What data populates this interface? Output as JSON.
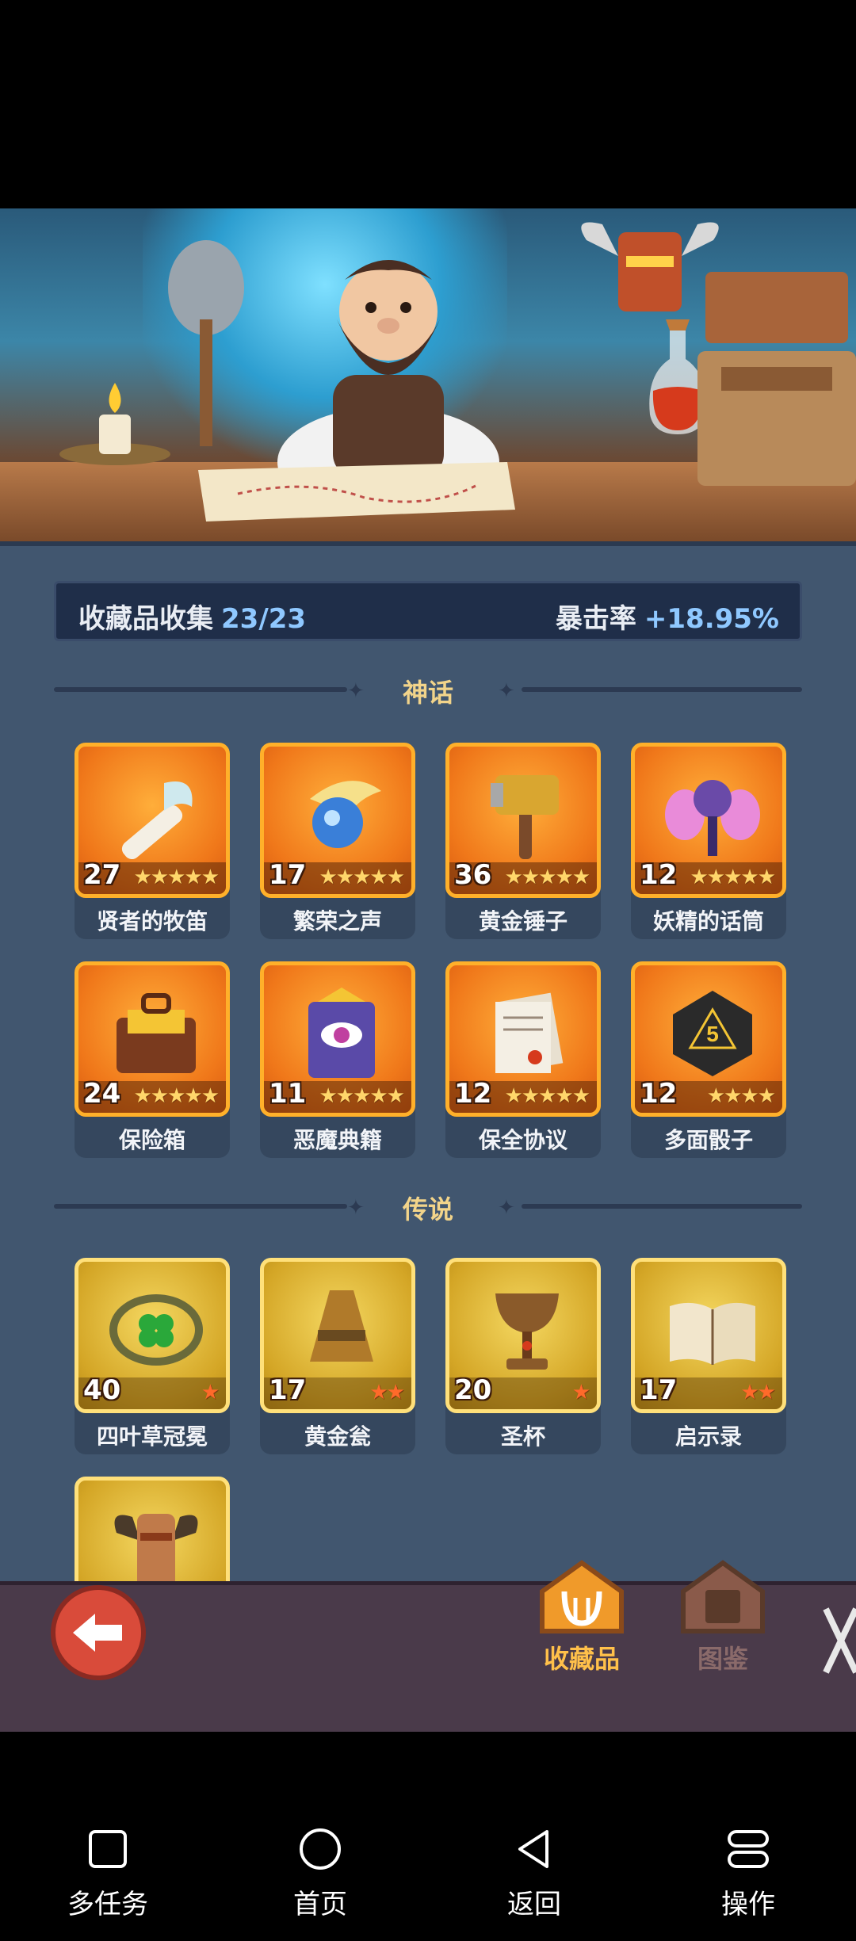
{
  "summary": {
    "collection_label": "收藏品收集",
    "collection_value": "23/23",
    "crit_label": "暴击率",
    "crit_value": "+18.95%"
  },
  "sections": {
    "mythic": "神话",
    "legend": "传说"
  },
  "mythic_items": [
    {
      "name": "贤者的牧笛",
      "count": "27",
      "stars": "★★★★★",
      "icon": "flute-icon"
    },
    {
      "name": "繁荣之声",
      "count": "17",
      "stars": "★★★★★",
      "icon": "horn-icon"
    },
    {
      "name": "黄金锤子",
      "count": "36",
      "stars": "★★★★★",
      "icon": "hammer-icon"
    },
    {
      "name": "妖精的话筒",
      "count": "12",
      "stars": "★★★★★",
      "icon": "microphone-icon"
    },
    {
      "name": "保险箱",
      "count": "24",
      "stars": "★★★★★",
      "icon": "chest-icon"
    },
    {
      "name": "恶魔典籍",
      "count": "11",
      "stars": "★★★★★",
      "icon": "demon-book-icon"
    },
    {
      "name": "保全协议",
      "count": "12",
      "stars": "★★★★★",
      "icon": "contract-icon"
    },
    {
      "name": "多面骰子",
      "count": "12",
      "stars": "★★★★",
      "icon": "dice-icon"
    }
  ],
  "legend_items": [
    {
      "name": "四叶草冠冕",
      "count": "40",
      "stars": "★",
      "icon": "clover-crown-icon"
    },
    {
      "name": "黄金瓮",
      "count": "17",
      "stars": "★★",
      "icon": "golden-urn-icon"
    },
    {
      "name": "圣杯",
      "count": "20",
      "stars": "★",
      "icon": "grail-icon"
    },
    {
      "name": "启示录",
      "count": "17",
      "stars": "★★",
      "icon": "revelation-book-icon"
    }
  ],
  "footer": {
    "tab_collection": "收藏品",
    "tab_codex": "图鉴"
  },
  "navbar": {
    "multitask": "多任务",
    "home": "首页",
    "back": "返回",
    "operate": "操作"
  }
}
